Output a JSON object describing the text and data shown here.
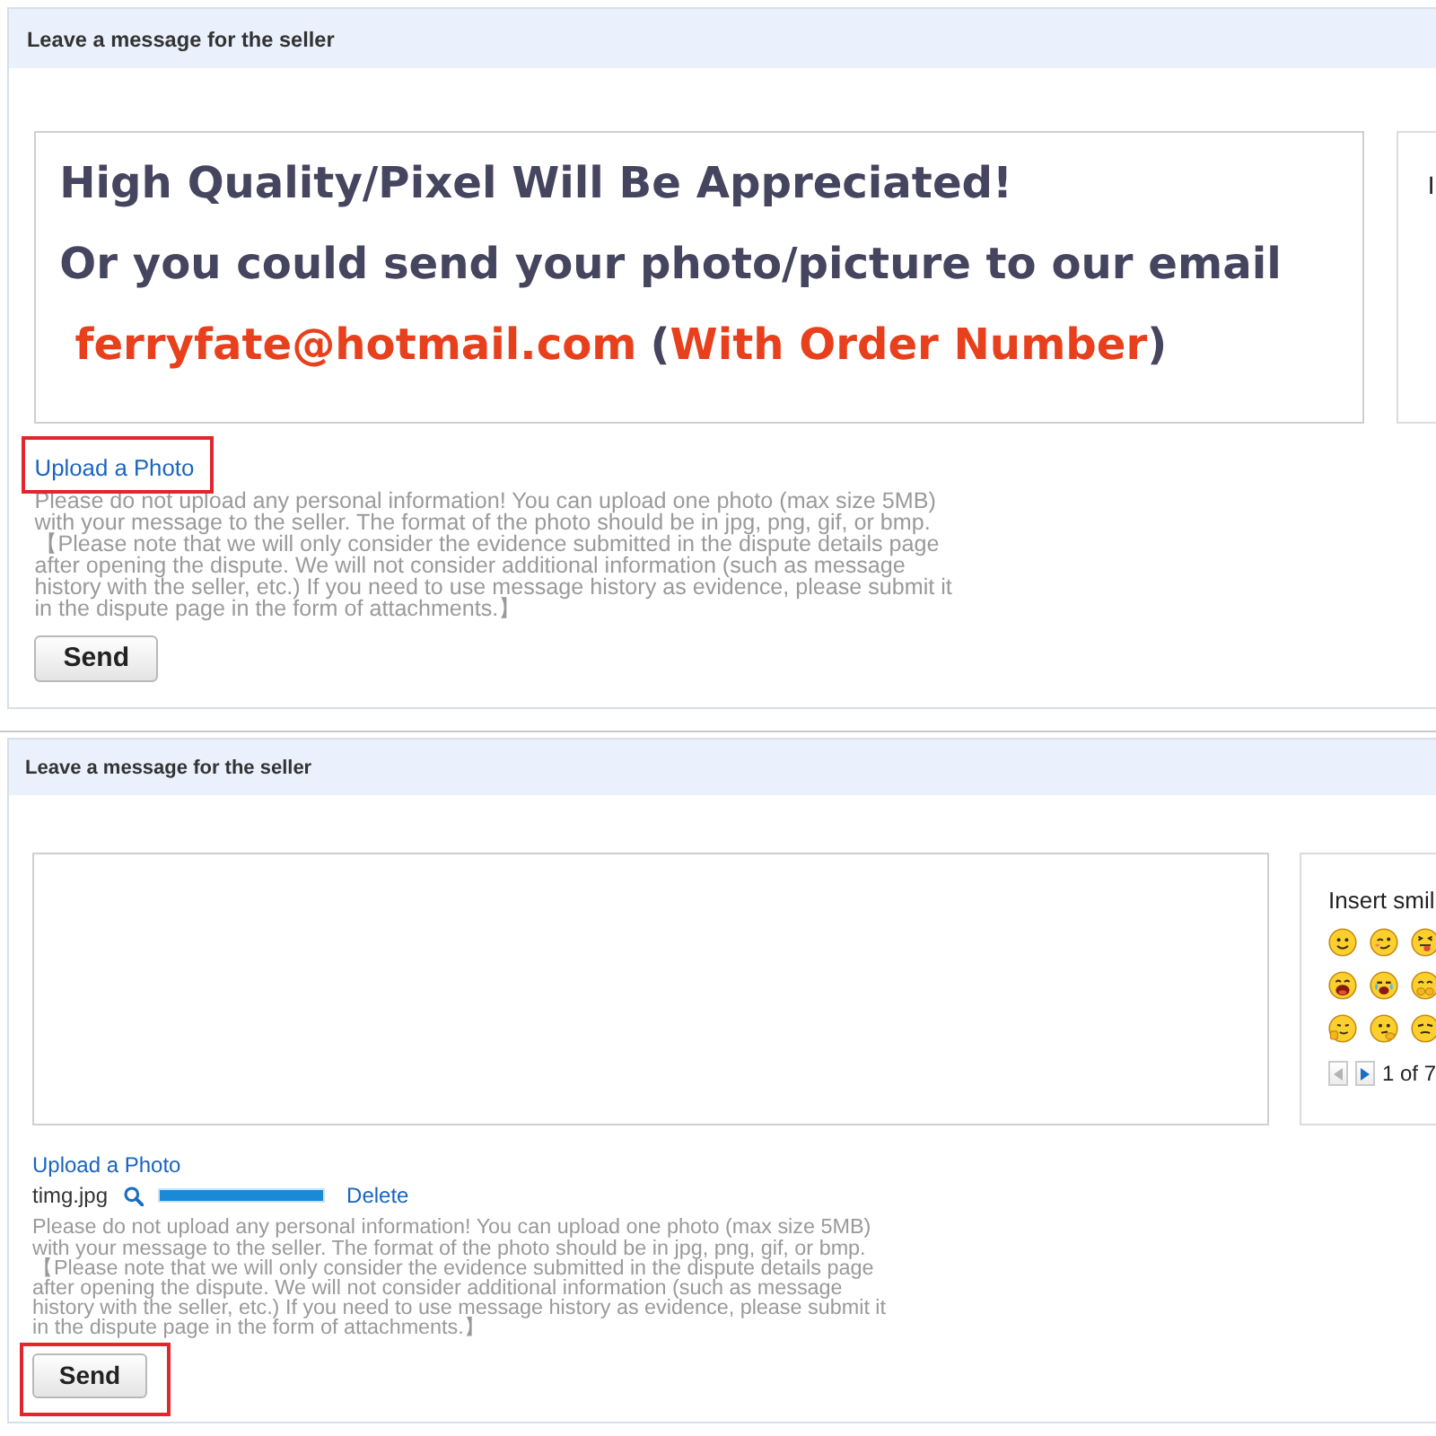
{
  "panels": [
    {
      "title": "Leave a message for the seller",
      "message_field": {
        "lines": [
          "High Quality/Pixel Will Be Appreciated!",
          "Or you could send your photo/picture to our email"
        ],
        "contact": {
          "email": "ferryfate@hotmail.com",
          "note_open": "(",
          "note": "With Order Number",
          "note_close": ")"
        }
      },
      "smiley_panel": {
        "title": "I"
      },
      "upload_link": {
        "label": "Upload a Photo",
        "highlighted": true
      },
      "notice": "Please do not upload any personal information! You can upload one photo (max size 5MB) with your message to the seller. The format of the photo should be in jpg, png, gif, or bmp. 【Please note that we will only consider the evidence submitted in the dispute details page after opening the dispute. We will not consider additional information (such as message history with the seller, etc.) If you need to use message history as evidence, please submit it in the dispute page in the form of attachments.】",
      "send_button": {
        "label": "Send",
        "highlighted": false
      }
    },
    {
      "title": "Leave a message for the seller",
      "smiley_panel": {
        "title": "Insert smil",
        "emoticons": [
          {
            "kind": "smile"
          },
          {
            "kind": "wink"
          },
          {
            "kind": "tongue"
          },
          {
            "kind": "laugh"
          },
          {
            "kind": "tears"
          },
          {
            "kind": "shy"
          },
          {
            "kind": "thumb"
          },
          {
            "kind": "think"
          },
          {
            "kind": "smirk"
          }
        ],
        "pager": {
          "label": "1 of 7",
          "buttons": [
            {
              "kind": "previous",
              "disabled": true
            },
            {
              "kind": "next",
              "disabled": false
            }
          ]
        }
      },
      "upload_link": {
        "label": "Upload a Photo",
        "highlighted": false
      },
      "attachment": {
        "file_name": "timg.jpg",
        "level": 1,
        "delete_label": "Delete"
      },
      "notice": "Please do not upload any personal information! You can upload one photo (max size 5MB) with your message to the seller. The format of the photo should be in jpg, png, gif, or bmp. 【Please note that we will only consider the evidence submitted in the dispute details page after opening the dispute. We will not consider additional information (such as message history with the seller, etc.) If you need to use message history as evidence, please submit it in the dispute page in the form of attachments.】",
      "send_button": {
        "label": "Send",
        "highlighted": true
      }
    }
  ]
}
